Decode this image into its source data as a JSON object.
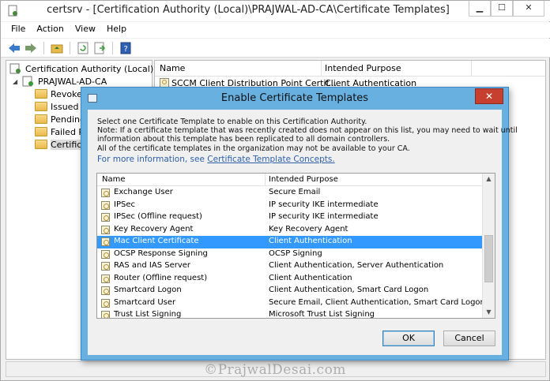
{
  "window": {
    "title": "certsrv - [Certification Authority (Local)\\PRAJWAL-AD-CA\\Certificate Templates]",
    "minimize": "▁",
    "maximize": "☐",
    "close": "✕"
  },
  "menu": [
    "File",
    "Action",
    "View",
    "Help"
  ],
  "toolbar": {
    "icons": [
      "back-arrow-icon",
      "forward-arrow-icon",
      "up-folder-icon",
      "refresh-icon",
      "export-list-icon",
      "help-icon"
    ]
  },
  "tree": {
    "root": "Certification Authority (Local)",
    "ca": "PRAJWAL-AD-CA",
    "expander": "◢",
    "children": [
      "Revoked",
      "Issued C",
      "Pending",
      "Failed R",
      "Certifica"
    ]
  },
  "list": {
    "headers": [
      "Name",
      "Intended Purpose"
    ],
    "rows": [
      {
        "name": "SCCM Client Distribution Point Certif...",
        "purpose": "Client Authentication"
      }
    ]
  },
  "dialog": {
    "title": "Enable Certificate Templates",
    "close": "✕",
    "instructions": [
      "Select one Certificate Template to enable on this Certification Authority.",
      "Note: If a certificate template that was recently created does not appear on this list, you may need to wait until",
      "information about this template has been replicated to all domain controllers.",
      "All of the certificate templates in the organization may not be available to your CA."
    ],
    "more_info_prefix": "For more information, see",
    "more_info_link": "Certificate Template Concepts.",
    "headers": [
      "Name",
      "Intended Purpose"
    ],
    "rows": [
      {
        "name": "Exchange User",
        "purpose": "Secure Email"
      },
      {
        "name": "IPSec",
        "purpose": "IP security IKE intermediate"
      },
      {
        "name": "IPSec (Offline request)",
        "purpose": "IP security IKE intermediate"
      },
      {
        "name": "Key Recovery Agent",
        "purpose": "Key Recovery Agent"
      },
      {
        "name": "Mac Client Certificate",
        "purpose": "Client Authentication",
        "selected": true
      },
      {
        "name": "OCSP Response Signing",
        "purpose": "OCSP Signing"
      },
      {
        "name": "RAS and IAS Server",
        "purpose": "Client Authentication, Server Authentication"
      },
      {
        "name": "Router (Offline request)",
        "purpose": "Client Authentication"
      },
      {
        "name": "Smartcard Logon",
        "purpose": "Client Authentication, Smart Card Logon"
      },
      {
        "name": "Smartcard User",
        "purpose": "Secure Email, Client Authentication, Smart Card Logon"
      },
      {
        "name": "Trust List Signing",
        "purpose": "Microsoft Trust List Signing"
      }
    ],
    "scroll_up": "▲",
    "scroll_down": "▼",
    "ok": "OK",
    "cancel": "Cancel"
  },
  "watermark": "©PrajwalDesai.com"
}
